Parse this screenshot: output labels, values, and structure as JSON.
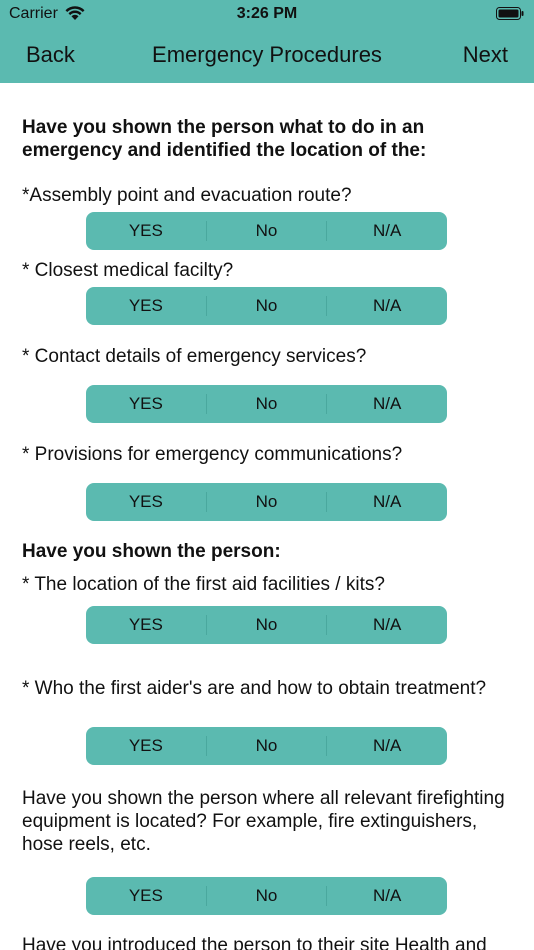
{
  "status": {
    "carrier": "Carrier",
    "time": "3:26 PM"
  },
  "nav": {
    "back": "Back",
    "title": "Emergency Procedures",
    "next": "Next"
  },
  "options": {
    "yes": "YES",
    "no": "No",
    "na": "N/A"
  },
  "sections": {
    "heading1": "Have you shown the person what to do in an emergency and identified the location of the:",
    "heading2": "Have you shown the person:"
  },
  "questions": [
    "*Assembly point and evacuation route?",
    "* Closest medical facilty?",
    "* Contact details of emergency services?",
    "* Provisions for emergency communications?",
    "* The location of the first aid facilities / kits?",
    "* Who the first aider's are and how to obtain treatment?",
    "Have you shown the person where all relevant firefighting equipment is located? For example, fire extinguishers, hose reels, etc.",
    "Have you introduced the person to their site Health and"
  ],
  "colors": {
    "accent": "#5bbab0",
    "divider": "#4aa89e"
  }
}
